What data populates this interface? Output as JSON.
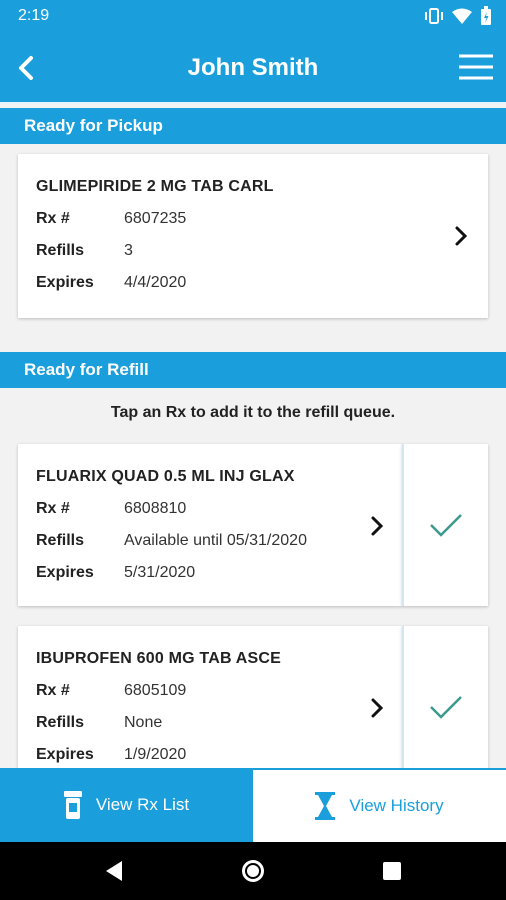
{
  "status_bar": {
    "time": "2:19"
  },
  "header": {
    "title": "John Smith"
  },
  "sections": {
    "pickup": {
      "title": "Ready for Pickup"
    },
    "refill": {
      "title": "Ready for Refill",
      "instruction": "Tap an Rx to add it to the refill queue."
    }
  },
  "labels": {
    "rx": "Rx #",
    "refills": "Refills",
    "expires": "Expires"
  },
  "pickup_items": [
    {
      "name": "GLIMEPIRIDE 2 MG    TAB CARL",
      "rx": "6807235",
      "refills": "3",
      "expires": "4/4/2020"
    }
  ],
  "refill_items": [
    {
      "name": "FLUARIX QUAD 0.5 ML INJ GLAX",
      "rx": "6808810",
      "refills": "Available until 05/31/2020",
      "expires": "5/31/2020"
    },
    {
      "name": "IBUPROFEN 600 MG    TAB ASCE",
      "rx": "6805109",
      "refills": "None",
      "expires": "1/9/2020"
    }
  ],
  "bottom_nav": {
    "rx_list": "View Rx List",
    "history": "View History"
  },
  "colors": {
    "brand": "#1a9fdc",
    "check": "#3d9a8e"
  },
  "icons": [
    "back-icon",
    "menu-icon",
    "chevron-right-icon",
    "checkmark-icon",
    "pill-bottle-icon",
    "hourglass-icon"
  ]
}
